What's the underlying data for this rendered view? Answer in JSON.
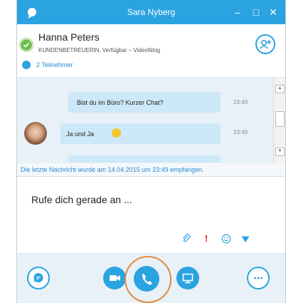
{
  "window": {
    "title": "Sara Nyberg",
    "minimize_glyph": "–",
    "maximize_glyph": "□",
    "close_glyph": "✕"
  },
  "contact": {
    "name": "Hanna Peters",
    "subtitle": "KUNDENBETREUERIN, Verfügbar – Videofähig",
    "participants": "2 Teilnehmer",
    "status_color": "#6bbf4a"
  },
  "messages": [
    {
      "text": "Bist du im Büro? Kurzer Chat?",
      "time": "23:49"
    },
    {
      "text": "Ja und Ja",
      "time": "23:49"
    }
  ],
  "notice": "Die letzte Nachricht wurde am 14.04.2015 um 23:49 empfangen.",
  "compose": {
    "text": "Rufe dich gerade an ...",
    "important_glyph": "!"
  },
  "colors": {
    "accent": "#2aa3e0",
    "highlight_ring": "#e08a3a",
    "important": "#e01e1e"
  },
  "icons": [
    "skype-logo-icon",
    "add-person-icon",
    "participants-icon",
    "paperclip-icon",
    "important-icon",
    "smiley-icon",
    "send-icon",
    "chat-icon",
    "video-icon",
    "phone-icon",
    "screen-share-icon",
    "more-options-icon"
  ]
}
